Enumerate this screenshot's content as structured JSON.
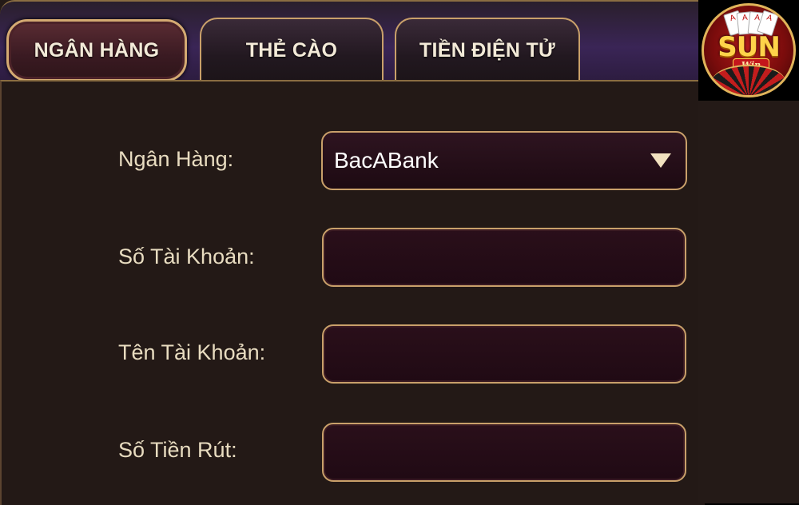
{
  "tabs": [
    {
      "label": "NGÂN HÀNG",
      "active": true
    },
    {
      "label": "THẺ CÀO",
      "active": false
    },
    {
      "label": "TIỀN ĐIỆN TỬ",
      "active": false
    }
  ],
  "form": {
    "bank_label": "Ngân Hàng:",
    "bank_value": "BacABank",
    "account_number_label": "Số Tài Khoản:",
    "account_number_value": "",
    "account_name_label": "Tên Tài Khoản:",
    "account_name_value": "",
    "amount_label": "Số Tiền Rút:",
    "amount_value": ""
  },
  "logo": {
    "brand": "SUN",
    "sub": "Win"
  },
  "colors": {
    "gold_border": "#c9a06a",
    "panel_bg": "#231916",
    "field_bg": "#200a14",
    "label_text": "#e8dcc0"
  }
}
